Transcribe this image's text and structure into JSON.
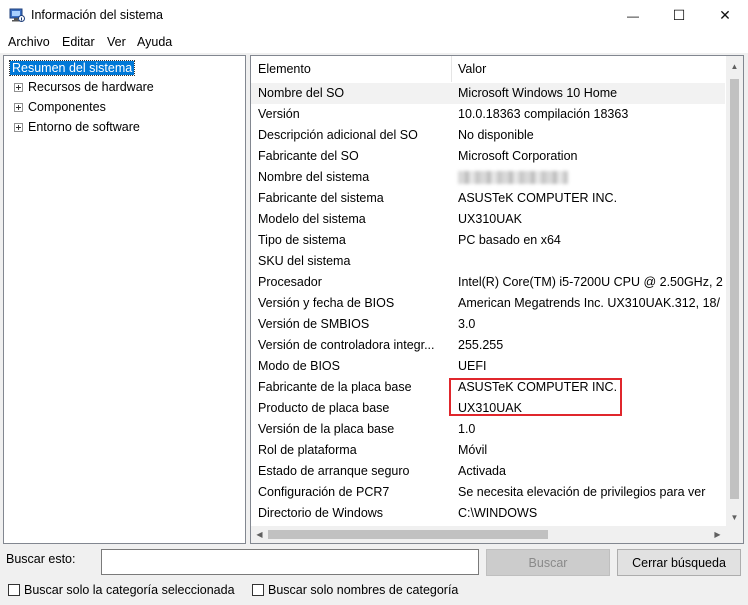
{
  "window": {
    "title": "Información del sistema",
    "controls": {
      "minimize": "—",
      "maximize": "☐",
      "close": "✕"
    }
  },
  "menu": [
    "Archivo",
    "Editar",
    "Ver",
    "Ayuda"
  ],
  "tree": {
    "selected": "Resumen del sistema",
    "children": [
      "Recursos de hardware",
      "Componentes",
      "Entorno de software"
    ]
  },
  "table": {
    "headers": {
      "item": "Elemento",
      "value": "Valor"
    },
    "rows": [
      {
        "name": "Nombre del SO",
        "value": "Microsoft Windows 10 Home"
      },
      {
        "name": "Versión",
        "value": "10.0.18363 compilación 18363"
      },
      {
        "name": "Descripción adicional del SO",
        "value": "No disponible"
      },
      {
        "name": "Fabricante del SO",
        "value": "Microsoft Corporation"
      },
      {
        "name": "Nombre del sistema",
        "value": ""
      },
      {
        "name": "Fabricante del sistema",
        "value": "ASUSTeK COMPUTER INC."
      },
      {
        "name": "Modelo del sistema",
        "value": "UX310UAK"
      },
      {
        "name": "Tipo de sistema",
        "value": "PC basado en x64"
      },
      {
        "name": "SKU del sistema",
        "value": ""
      },
      {
        "name": "Procesador",
        "value": "Intel(R) Core(TM) i5-7200U CPU @ 2.50GHz, 2"
      },
      {
        "name": "Versión y fecha de BIOS",
        "value": "American Megatrends Inc. UX310UAK.312, 18/"
      },
      {
        "name": "Versión de SMBIOS",
        "value": "3.0"
      },
      {
        "name": "Versión de controladora integr...",
        "value": "255.255"
      },
      {
        "name": "Modo de BIOS",
        "value": "UEFI"
      },
      {
        "name": "Fabricante de la placa base",
        "value": "ASUSTeK COMPUTER INC."
      },
      {
        "name": "Producto de placa base",
        "value": "UX310UAK"
      },
      {
        "name": "Versión de la placa base",
        "value": "1.0"
      },
      {
        "name": "Rol de plataforma",
        "value": "Móvil"
      },
      {
        "name": "Estado de arranque seguro",
        "value": "Activada"
      },
      {
        "name": "Configuración de PCR7",
        "value": "Se necesita elevación de privilegios para ver"
      },
      {
        "name": "Directorio de Windows",
        "value": "C:\\WINDOWS"
      }
    ]
  },
  "search": {
    "label": "Buscar esto:",
    "value": "",
    "find_button": "Buscar",
    "close_button": "Cerrar búsqueda",
    "option_selected_category": "Buscar solo la categoría seleccionada",
    "option_category_names": "Buscar solo nombres de categoría"
  },
  "colors": {
    "selection": "#0078d7",
    "highlight_box": "#e0262c"
  }
}
